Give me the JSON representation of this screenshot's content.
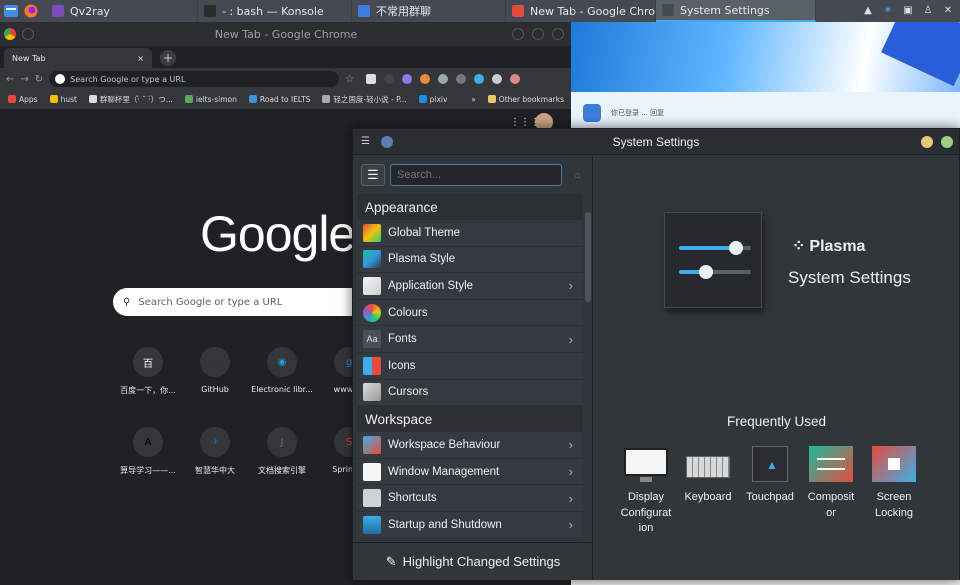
{
  "panel": {
    "tasks": [
      {
        "label": "Qv2ray",
        "color": "#7a4fb8"
      },
      {
        "label": "- : bash — Konsole",
        "color": "#2b2b2b"
      },
      {
        "label": "不常用群聊",
        "color": "#3c7ee0"
      },
      {
        "label": "New Tab - Google Chrome",
        "color": "#e24c3c"
      },
      {
        "label": "System Settings",
        "color": "#444b52"
      }
    ]
  },
  "chrome": {
    "window_title": "New Tab - Google Chrome",
    "tab_label": "New Tab",
    "tab_close": "×",
    "new_tab": "+",
    "omnibox_placeholder": "Search Google or type a URL",
    "bookmarks": [
      "Apps",
      "hust",
      "群聊杯里（·̀ ˘ ·́）つ...",
      "ielts-simon",
      "Road to IELTS",
      "轻之国度-轻小说 - P...",
      "pixiv",
      "»",
      "Other bookmarks"
    ],
    "logo": "Google",
    "search_placeholder": "Search Google or type a URL",
    "shortcuts": [
      {
        "label": "百度一下，你...",
        "icon": "百"
      },
      {
        "label": "GitHub",
        "icon": "◎"
      },
      {
        "label": "Electronic libr...",
        "icon": "◉"
      },
      {
        "label": "www.gs",
        "icon": "g"
      },
      {
        "label": "算导学习——...",
        "icon": "A"
      },
      {
        "label": "智慧华中大",
        "icon": "✈"
      },
      {
        "label": "文档搜索引擎",
        "icon": "J"
      },
      {
        "label": "Spring S",
        "icon": "S"
      }
    ]
  },
  "settings": {
    "window_title": "System Settings",
    "search_placeholder": "Search...",
    "categories": [
      {
        "label": "Appearance",
        "items": [
          {
            "label": "Global Theme",
            "icon": "global-theme-icon",
            "chevron": false
          },
          {
            "label": "Plasma Style",
            "icon": "plasma-style-icon",
            "chevron": false
          },
          {
            "label": "Application Style",
            "icon": "application-style-icon",
            "chevron": true
          },
          {
            "label": "Colours",
            "icon": "colours-icon",
            "chevron": false
          },
          {
            "label": "Fonts",
            "icon": "fonts-icon",
            "chevron": true
          },
          {
            "label": "Icons",
            "icon": "icons-icon",
            "chevron": false
          },
          {
            "label": "Cursors",
            "icon": "cursors-icon",
            "chevron": false
          }
        ]
      },
      {
        "label": "Workspace",
        "items": [
          {
            "label": "Workspace Behaviour",
            "icon": "workspace-behaviour-icon",
            "chevron": true
          },
          {
            "label": "Window Management",
            "icon": "window-management-icon",
            "chevron": true
          },
          {
            "label": "Shortcuts",
            "icon": "shortcuts-icon",
            "chevron": true
          },
          {
            "label": "Startup and Shutdown",
            "icon": "startup-shutdown-icon",
            "chevron": true
          }
        ]
      }
    ],
    "highlight_button": "Highlight Changed Settings",
    "brand": "Plasma",
    "subtitle": "System Settings",
    "frequently_used_title": "Frequently Used",
    "frequently_used": [
      {
        "line1": "Display",
        "line2": "Configurat",
        "line3": "ion",
        "icon": "display-icon"
      },
      {
        "line1": "Keyboard",
        "line2": "",
        "line3": "",
        "icon": "keyboard-icon"
      },
      {
        "line1": "Touchpad",
        "line2": "",
        "line3": "",
        "icon": "touchpad-icon"
      },
      {
        "line1": "Composit",
        "line2": "or",
        "line3": "",
        "icon": "compositor-icon"
      },
      {
        "line1": "Screen",
        "line2": "Locking",
        "line3": "",
        "icon": "screen-locking-icon"
      }
    ]
  },
  "bg_window": {
    "snippet": "你已登录 ... 回复"
  },
  "colors": {
    "accent": "#3daee9",
    "panel": "#454a52",
    "settings_bg": "#31363b"
  }
}
